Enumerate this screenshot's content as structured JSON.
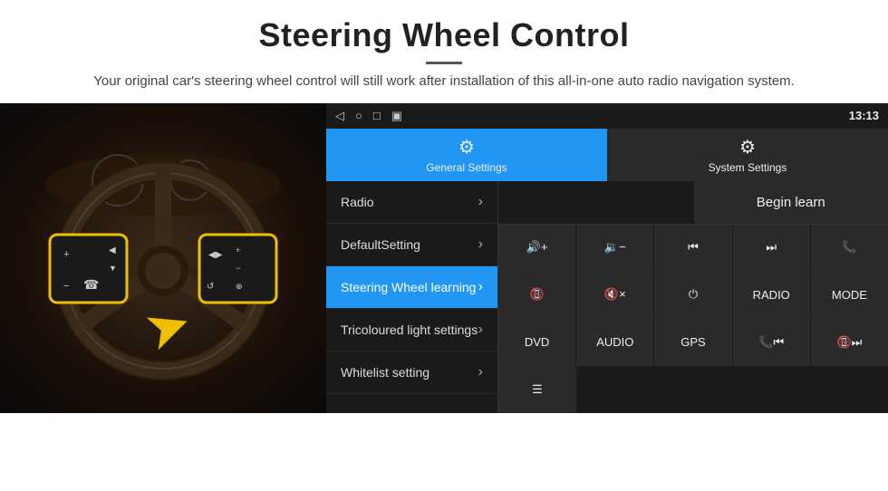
{
  "header": {
    "title": "Steering Wheel Control",
    "divider": true,
    "subtitle": "Your original car's steering wheel control will still work after installation of this all-in-one auto radio navigation system."
  },
  "status_bar": {
    "time": "13:13",
    "icons": [
      "◁",
      "○",
      "□",
      "▣"
    ]
  },
  "tabs": [
    {
      "id": "general",
      "label": "General Settings",
      "icon": "⚙",
      "active": true
    },
    {
      "id": "system",
      "label": "System Settings",
      "icon": "🔧",
      "active": false
    }
  ],
  "menu": {
    "items": [
      {
        "label": "Radio",
        "active": false
      },
      {
        "label": "DefaultSetting",
        "active": false
      },
      {
        "label": "Steering Wheel learning",
        "active": true
      },
      {
        "label": "Tricoloured light settings",
        "active": false
      },
      {
        "label": "Whitelist setting",
        "active": false
      }
    ]
  },
  "control_panel": {
    "begin_learn_label": "Begin learn",
    "button_rows": [
      [
        {
          "id": "vol-up",
          "label": "🔊+",
          "text": ""
        },
        {
          "id": "vol-down",
          "label": "🔇-",
          "text": ""
        },
        {
          "id": "prev-track",
          "label": "⏮",
          "text": ""
        },
        {
          "id": "next-track",
          "label": "⏭",
          "text": ""
        },
        {
          "id": "phone",
          "label": "📞",
          "text": ""
        }
      ],
      [
        {
          "id": "hang-up",
          "label": "📵",
          "text": ""
        },
        {
          "id": "mute",
          "label": "🔇×",
          "text": ""
        },
        {
          "id": "power",
          "label": "⏻",
          "text": ""
        },
        {
          "id": "radio-btn",
          "label": "",
          "text": "RADIO"
        },
        {
          "id": "mode-btn",
          "label": "",
          "text": "MODE"
        }
      ],
      [
        {
          "id": "dvd-btn",
          "label": "",
          "text": "DVD"
        },
        {
          "id": "audio-btn",
          "label": "",
          "text": "AUDIO"
        },
        {
          "id": "gps-btn",
          "label": "",
          "text": "GPS"
        },
        {
          "id": "prev-combo",
          "label": "📞⏮",
          "text": ""
        },
        {
          "id": "next-combo",
          "label": "📵⏭",
          "text": ""
        }
      ],
      [
        {
          "id": "menu-icon",
          "label": "☰",
          "text": ""
        }
      ]
    ]
  }
}
